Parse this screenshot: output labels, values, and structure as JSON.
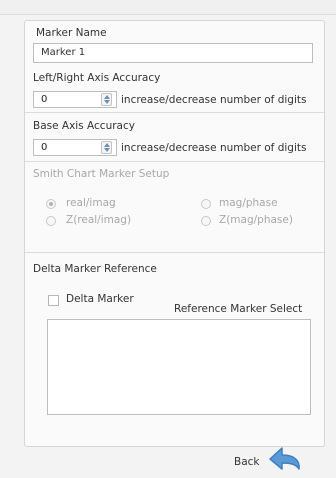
{
  "marker_name": {
    "label": "Marker Name",
    "value": "Marker 1"
  },
  "lr_axis": {
    "label": "Left/Right Axis Accuracy",
    "value": "0",
    "hint": "increase/decrease number of digits"
  },
  "base_axis": {
    "label": "Base Axis Accuracy",
    "value": "0",
    "hint": "increase/decrease number of digits"
  },
  "smith": {
    "title": "Smith Chart Marker Setup",
    "options": [
      "real/imag",
      "mag/phase",
      "Z(real/imag)",
      "Z(mag/phase)"
    ],
    "selected": "real/imag"
  },
  "delta": {
    "title": "Delta Marker Reference",
    "checkbox_label": "Delta Marker",
    "checked": false,
    "select_label": "Reference Marker Select"
  },
  "back_label": "Back",
  "colors": {
    "arrow": "#5b9bd5",
    "disabled_text": "#a8a8a8"
  },
  "icons": {
    "back": "back-arrow-icon",
    "spin": "spin-arrows-icon"
  }
}
